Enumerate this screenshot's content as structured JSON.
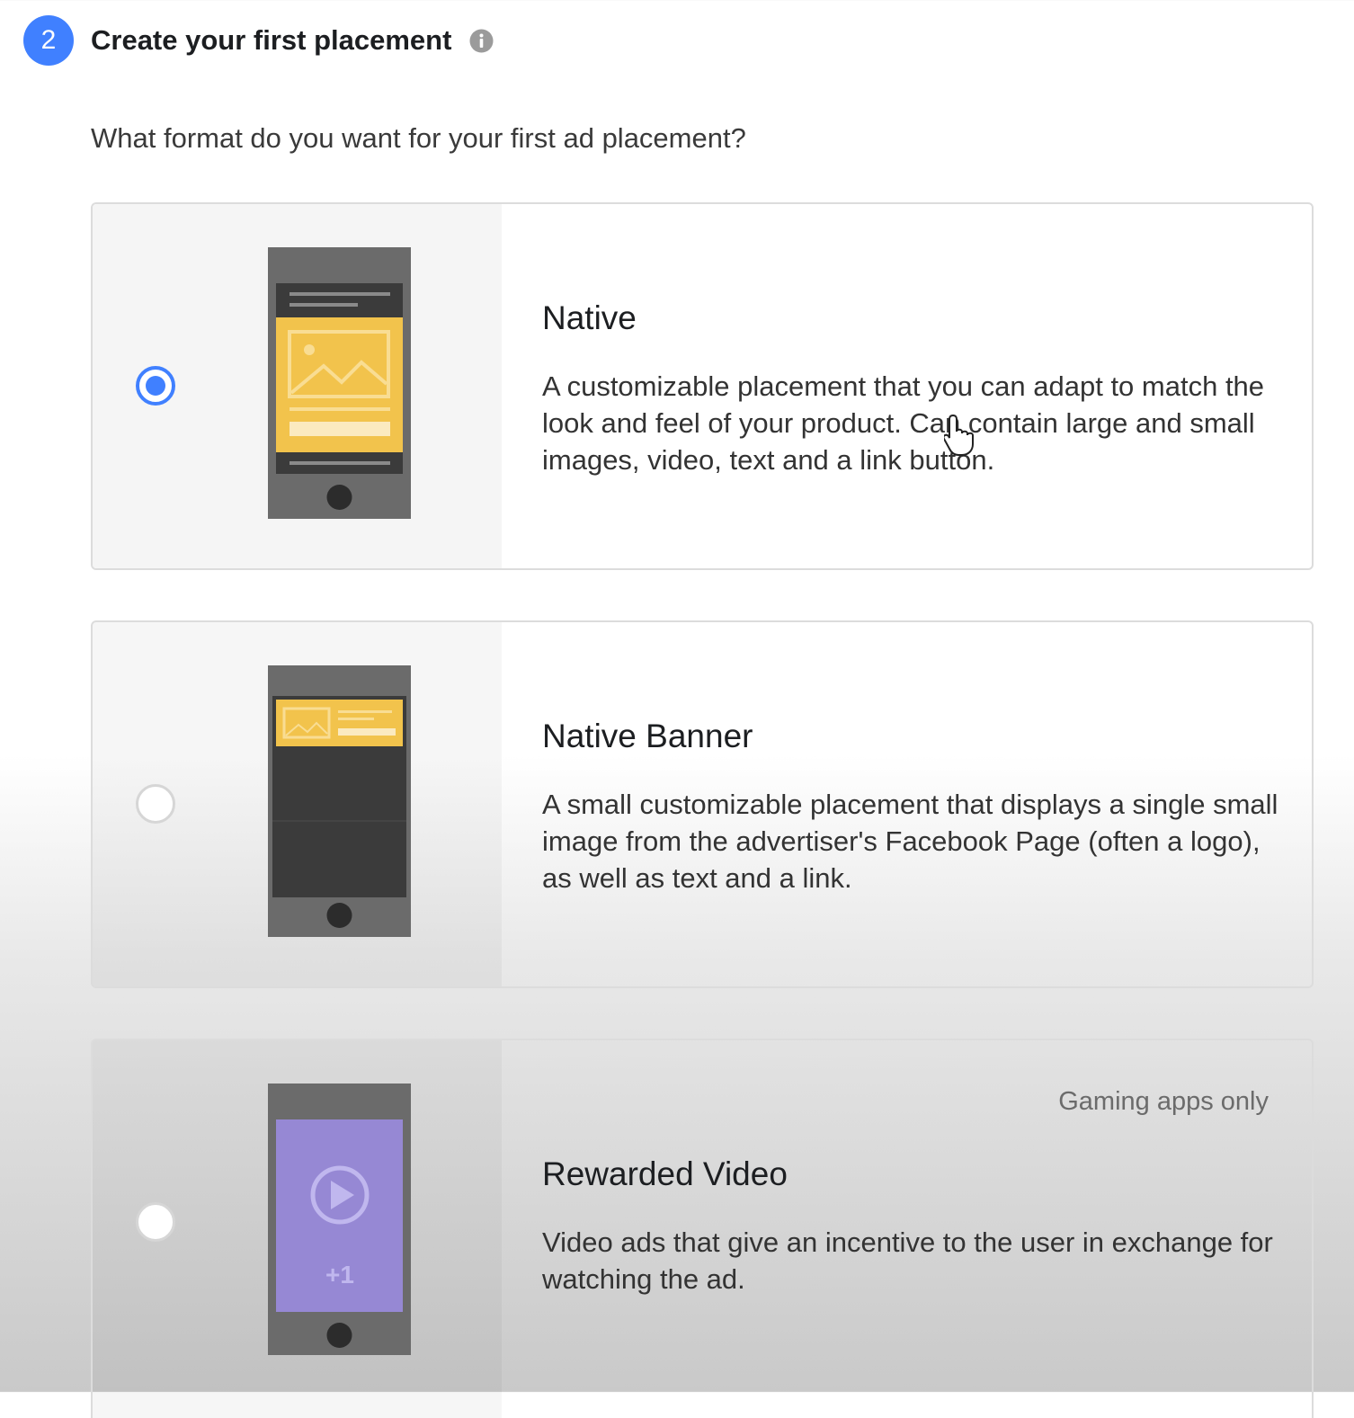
{
  "header": {
    "step_number": "2",
    "title": "Create your first placement",
    "info_icon": "info-icon"
  },
  "question": "What format do you want for your first ad placement?",
  "options": [
    {
      "title": "Native",
      "description": "A customizable placement that you can adapt to match the look and feel of your product. Can contain large and small images, video, text and a link button.",
      "selected": true,
      "illustration": "native-phone-illustration"
    },
    {
      "title": "Native Banner",
      "description": "A small customizable placement that displays a single small image from the advertiser's Facebook Page (often a logo), as well as text and a link.",
      "selected": false,
      "illustration": "native-banner-phone-illustration"
    },
    {
      "title": "Rewarded Video",
      "description": "Video ads that give an incentive to the user in exchange for watching the ad.",
      "note": "Gaming apps only",
      "selected": false,
      "illustration": "rewarded-video-phone-illustration",
      "reward_label": "+1"
    }
  ],
  "colors": {
    "accent": "#4080ff",
    "phone_body": "#6b6b6b",
    "ad_yellow": "#f2c34c",
    "video_purple": "#9688d4"
  }
}
